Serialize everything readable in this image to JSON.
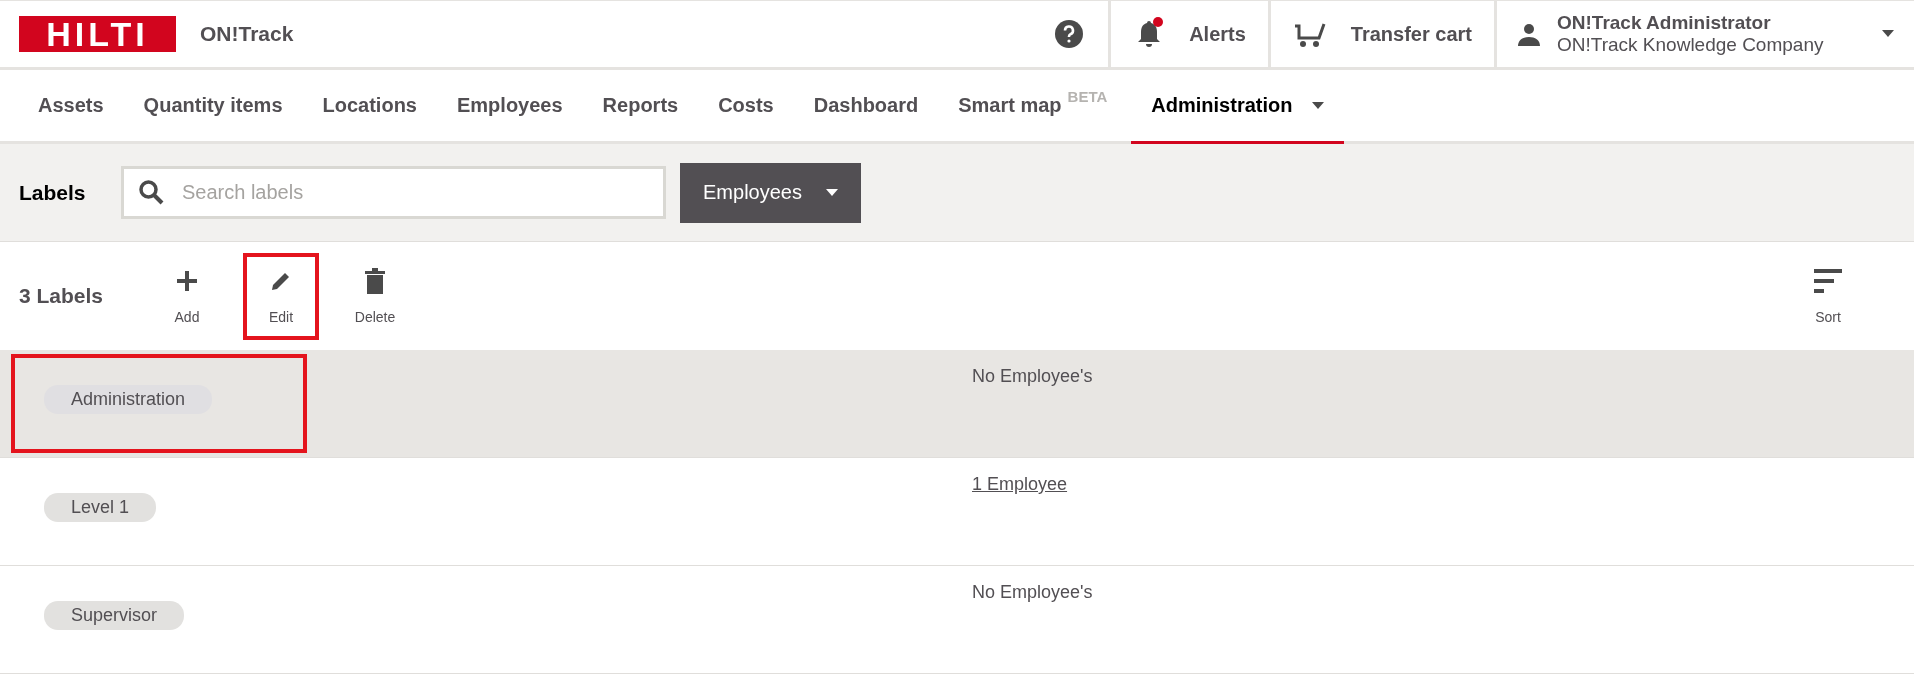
{
  "header": {
    "logo": "HILTI",
    "app_name": "ON!Track",
    "alerts": {
      "label": "Alerts",
      "unread": true
    },
    "transfer_cart": "Transfer cart",
    "user": {
      "name": "ON!Track Administrator",
      "company": "ON!Track Knowledge Company"
    }
  },
  "nav": [
    {
      "label": "Assets",
      "selected": false
    },
    {
      "label": "Quantity items",
      "selected": false
    },
    {
      "label": "Locations",
      "selected": false
    },
    {
      "label": "Employees",
      "selected": false
    },
    {
      "label": "Reports",
      "selected": false
    },
    {
      "label": "Costs",
      "selected": false
    },
    {
      "label": "Dashboard",
      "selected": false
    },
    {
      "label": "Smart map",
      "badge": "BETA",
      "selected": false
    },
    {
      "label": "Administration",
      "dropdown": true,
      "selected": true
    }
  ],
  "filter": {
    "title": "Labels",
    "search": {
      "placeholder": "Search labels"
    },
    "type_dropdown": "Employees"
  },
  "toolbar": {
    "count": "3 Labels",
    "actions": [
      {
        "kind": "add",
        "label": "Add",
        "highlighted": false
      },
      {
        "kind": "edit",
        "label": "Edit",
        "highlighted": true
      },
      {
        "kind": "delete",
        "label": "Delete",
        "highlighted": false
      }
    ],
    "sort": "Sort"
  },
  "rows": [
    {
      "label": "Administration",
      "employees": "No Employee's",
      "link": false,
      "selected": true,
      "highlighted": true
    },
    {
      "label": "Level 1",
      "employees": "1 Employee",
      "link": true,
      "selected": false,
      "highlighted": false
    },
    {
      "label": "Supervisor",
      "employees": "No Employee's",
      "link": false,
      "selected": false,
      "highlighted": false
    }
  ]
}
